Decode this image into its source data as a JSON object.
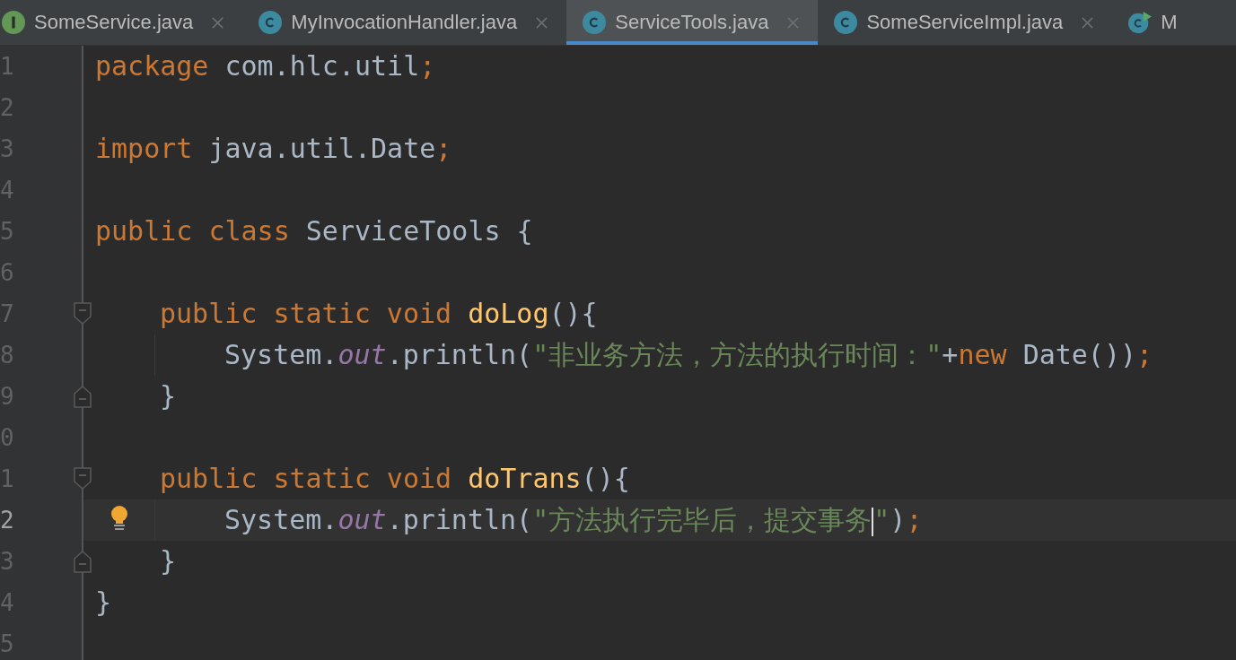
{
  "tabs": [
    {
      "label": "SomeService.java",
      "kind": "interface",
      "selected": false,
      "closable": true
    },
    {
      "label": "MyInvocationHandler.java",
      "kind": "class",
      "selected": false,
      "closable": true
    },
    {
      "label": "ServiceTools.java",
      "kind": "class",
      "selected": true,
      "closable": true
    },
    {
      "label": "SomeServiceImpl.java",
      "kind": "class",
      "selected": false,
      "closable": true
    },
    {
      "label": "M",
      "kind": "runnable",
      "selected": false,
      "closable": false
    }
  ],
  "lines": [
    {
      "number": "1",
      "fold_start": false,
      "fold_end": false,
      "current": false,
      "bulb": false,
      "tokens": [
        {
          "kind": "kw",
          "text": "package "
        },
        {
          "kind": "text",
          "text": "com.hlc.util"
        },
        {
          "kind": "kw",
          "text": ";"
        }
      ]
    },
    {
      "number": "2",
      "fold_start": false,
      "fold_end": false,
      "current": false,
      "bulb": false
    },
    {
      "number": "3",
      "fold_start": false,
      "fold_end": false,
      "current": false,
      "bulb": false,
      "tokens": [
        {
          "kind": "kw",
          "text": "import "
        },
        {
          "kind": "text",
          "text": "java.util.Date"
        },
        {
          "kind": "kw",
          "text": ";"
        }
      ]
    },
    {
      "number": "4",
      "fold_start": false,
      "fold_end": false,
      "current": false,
      "bulb": false
    },
    {
      "number": "5",
      "fold_start": false,
      "fold_end": false,
      "current": false,
      "bulb": false,
      "tokens": [
        {
          "kind": "kw",
          "text": "public class "
        },
        {
          "kind": "text",
          "text": "ServiceTools {"
        }
      ],
      "children": [
        {
          "number": "6",
          "fold_start": false,
          "fold_end": false,
          "current": false,
          "bulb": false
        },
        {
          "number": "7",
          "fold_start": true,
          "fold_end": false,
          "current": false,
          "bulb": false,
          "tokens": [
            {
              "kind": "kw",
              "text": "public static void "
            },
            {
              "kind": "fn",
              "text": "doLog"
            },
            {
              "kind": "text",
              "text": "(){"
            }
          ],
          "children": [
            {
              "number": "8",
              "fold_start": false,
              "fold_end": false,
              "current": false,
              "bulb": false,
              "tokens": [
                {
                  "kind": "text",
                  "text": "System."
                },
                {
                  "kind": "field",
                  "text": "out"
                },
                {
                  "kind": "text",
                  "text": ".println("
                },
                {
                  "kind": "str",
                  "text": "\"非业务方法，方法的执行时间：\""
                },
                {
                  "kind": "text",
                  "text": "+"
                },
                {
                  "kind": "kw",
                  "text": "new "
                },
                {
                  "kind": "text",
                  "text": "Date())"
                },
                {
                  "kind": "kw",
                  "text": ";"
                }
              ]
            }
          ]
        },
        {
          "number": "9",
          "fold_start": false,
          "fold_end": true,
          "current": false,
          "bulb": false,
          "tokens": [
            {
              "kind": "text",
              "text": "}"
            }
          ]
        },
        {
          "number": "0",
          "fold_start": false,
          "fold_end": false,
          "current": false,
          "bulb": false
        },
        {
          "number": "1",
          "fold_start": true,
          "fold_end": false,
          "current": false,
          "bulb": false,
          "tokens": [
            {
              "kind": "kw",
              "text": "public static void "
            },
            {
              "kind": "fn",
              "text": "doTrans"
            },
            {
              "kind": "text",
              "text": "(){"
            }
          ],
          "children": [
            {
              "number": "2",
              "fold_start": false,
              "fold_end": false,
              "current": true,
              "bulb": true,
              "tokens": [
                {
                  "kind": "text",
                  "text": "System."
                },
                {
                  "kind": "field",
                  "text": "out"
                },
                {
                  "kind": "text",
                  "text": ".println("
                },
                {
                  "kind": "str",
                  "text": "\"方法执行完毕后，提交事务"
                },
                {
                  "kind": "caret"
                },
                {
                  "kind": "str",
                  "text": "\""
                },
                {
                  "kind": "text",
                  "text": ")"
                },
                {
                  "kind": "kw",
                  "text": ";"
                }
              ]
            }
          ]
        },
        {
          "number": "3",
          "fold_start": false,
          "fold_end": true,
          "current": false,
          "bulb": false,
          "tokens": [
            {
              "kind": "text",
              "text": "}"
            }
          ]
        }
      ]
    },
    {
      "number": "4",
      "fold_start": false,
      "fold_end": false,
      "current": false,
      "bulb": false,
      "tokens": [
        {
          "kind": "text",
          "text": "}"
        }
      ]
    },
    {
      "number": "5",
      "fold_start": false,
      "fold_end": false,
      "current": false,
      "bulb": false
    }
  ]
}
